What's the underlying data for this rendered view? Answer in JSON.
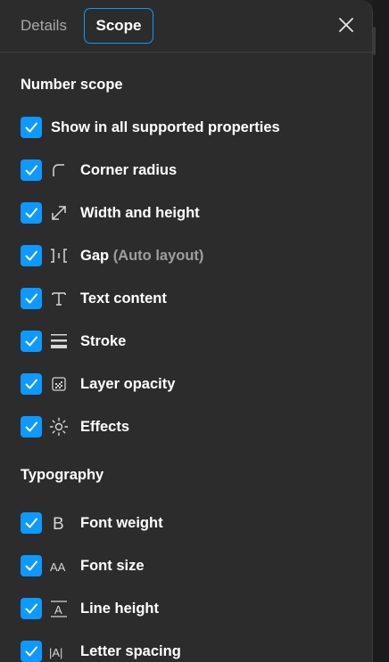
{
  "tabs": {
    "details": "Details",
    "scope": "Scope"
  },
  "sections": {
    "number_scope": "Number scope",
    "typography": "Typography"
  },
  "items": {
    "all": "Show in all supported properties",
    "corner_radius": "Corner radius",
    "width_height": "Width and height",
    "gap": "Gap",
    "gap_note": "(Auto layout)",
    "text_content": "Text content",
    "stroke": "Stroke",
    "layer_opacity": "Layer opacity",
    "effects": "Effects",
    "font_weight": "Font weight",
    "font_size": "Font size",
    "line_height": "Line height",
    "letter_spacing": "Letter spacing"
  },
  "icon_glyphs": {
    "text": "T",
    "font_weight": "B",
    "font_size": "AA",
    "line_height": "A",
    "letter_spacing": "|A|"
  },
  "colors": {
    "accent": "#0d99ff",
    "panel": "#2c2c2c"
  }
}
